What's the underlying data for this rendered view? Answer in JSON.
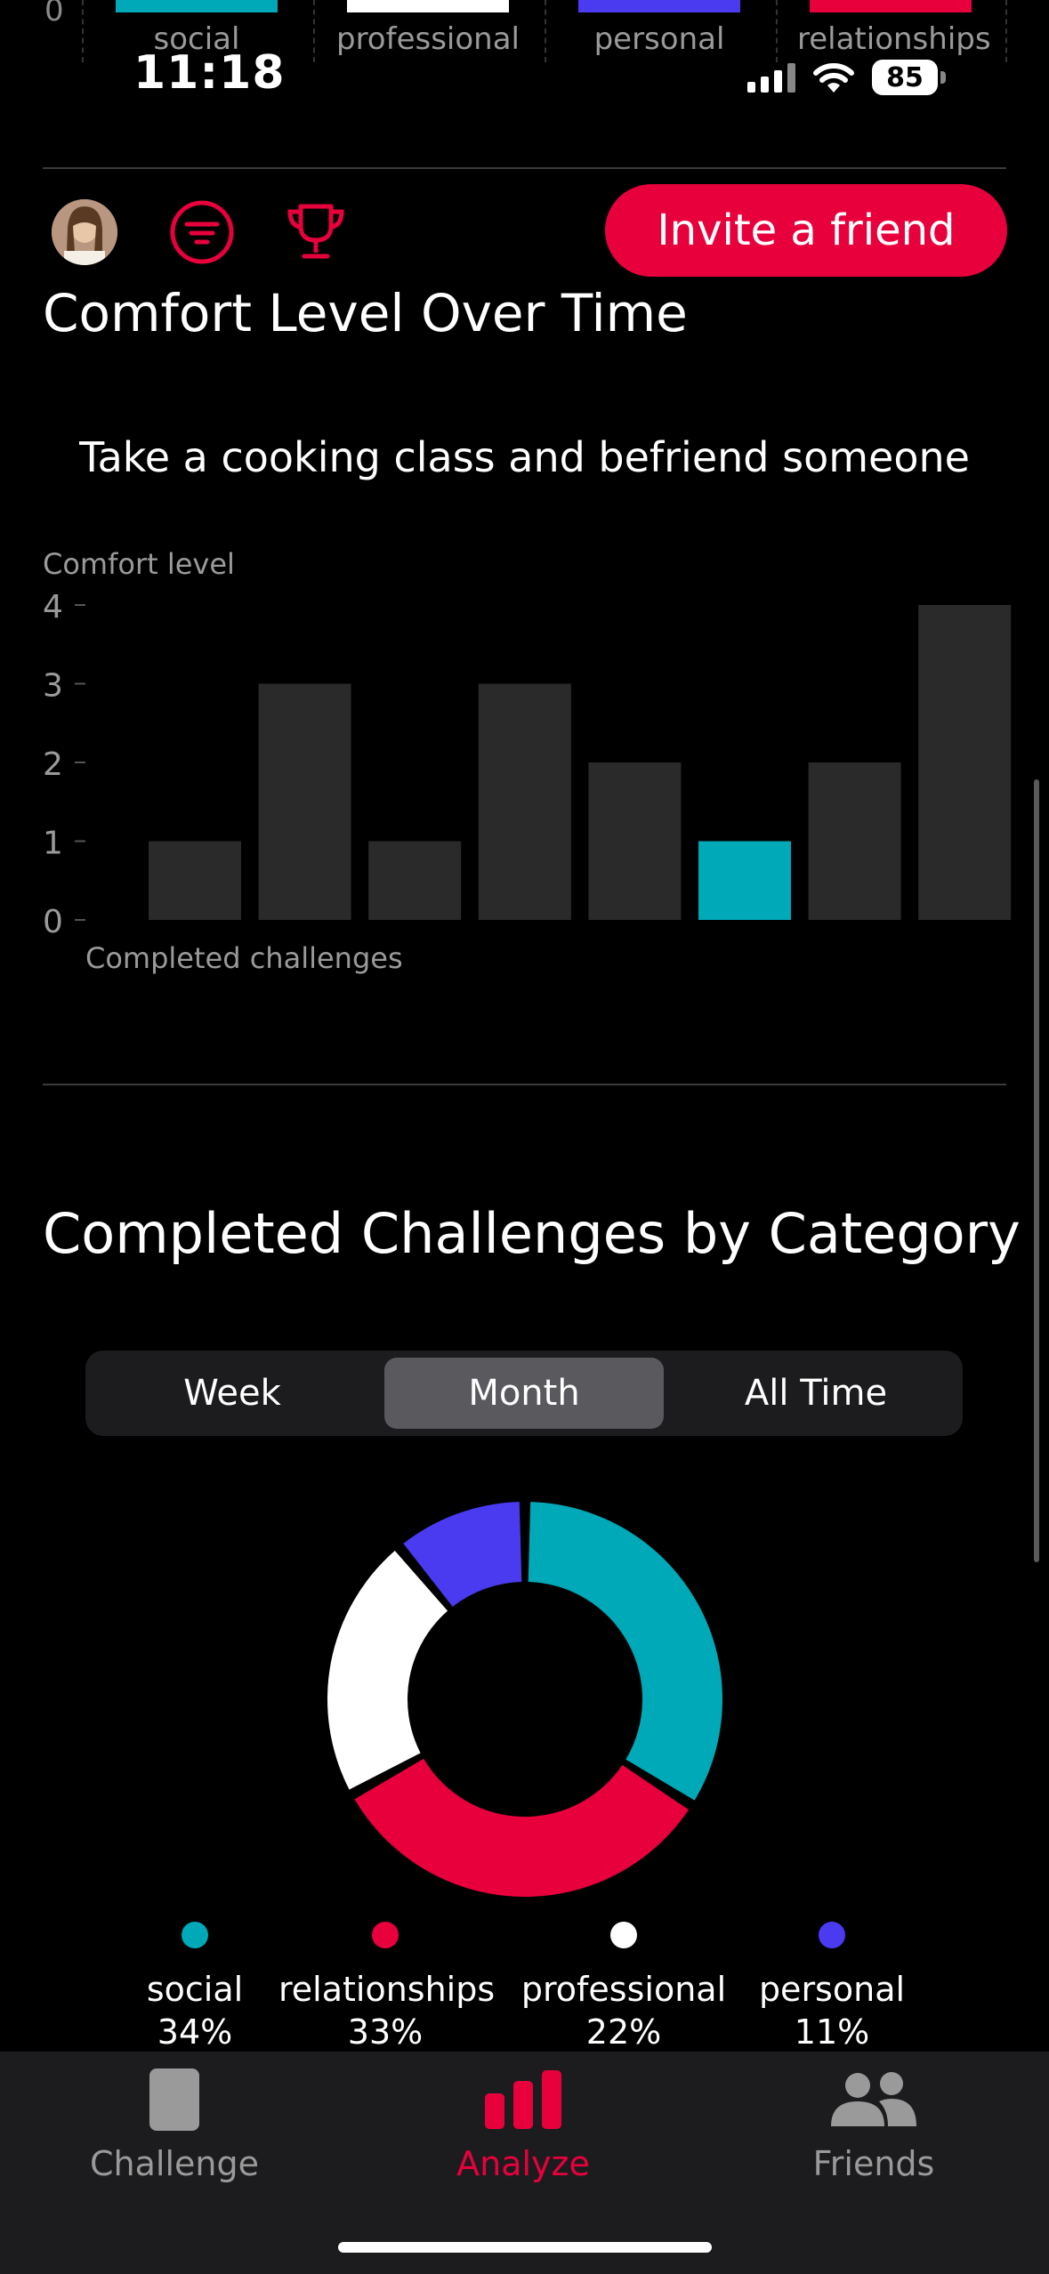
{
  "top_strip": {
    "zero_tick": "0",
    "labels": [
      "social",
      "professional",
      "personal",
      "relationships"
    ],
    "colors": [
      "#00a9b8",
      "#ffffff",
      "#4a3af0",
      "#e8003d"
    ]
  },
  "status_bar": {
    "time": "11:18",
    "battery": "85"
  },
  "toolbar": {
    "invite_label": "Invite a friend"
  },
  "comfort_section": {
    "title": "Comfort Level Over Time",
    "challenge_name": "Take a cooking class and befriend someone"
  },
  "chart_data": {
    "type": "bar",
    "ylabel": "Comfort level",
    "xlabel": "Completed challenges",
    "ylim": [
      0,
      4
    ],
    "yticks": [
      "0",
      "1",
      "2",
      "3",
      "4"
    ],
    "values": [
      1,
      3,
      1,
      3,
      2,
      1,
      2,
      4
    ],
    "highlight_index": 5,
    "bar_color": "#2a2a2a",
    "highlight_color": "#00a9b8"
  },
  "category_section": {
    "title": "Completed Challenges by Category",
    "tabs": [
      "Week",
      "Month",
      "All Time"
    ],
    "selected_tab": "Month",
    "slices": [
      {
        "name": "social",
        "percent": 34,
        "percent_label": "34%",
        "color": "#00a9b8"
      },
      {
        "name": "relationships",
        "percent": 33,
        "percent_label": "33%",
        "color": "#e8003d"
      },
      {
        "name": "professional",
        "percent": 22,
        "percent_label": "22%",
        "color": "#ffffff"
      },
      {
        "name": "personal",
        "percent": 11,
        "percent_label": "11%",
        "color": "#4a3af0"
      }
    ]
  },
  "tab_bar": {
    "items": [
      {
        "label": "Challenge",
        "icon": "challenge-card-icon"
      },
      {
        "label": "Analyze",
        "icon": "bar-chart-icon"
      },
      {
        "label": "Friends",
        "icon": "people-icon"
      }
    ],
    "active": "Analyze"
  },
  "colors": {
    "accent": "#e8003d",
    "teal": "#00a9b8",
    "purple": "#4a3af0"
  }
}
